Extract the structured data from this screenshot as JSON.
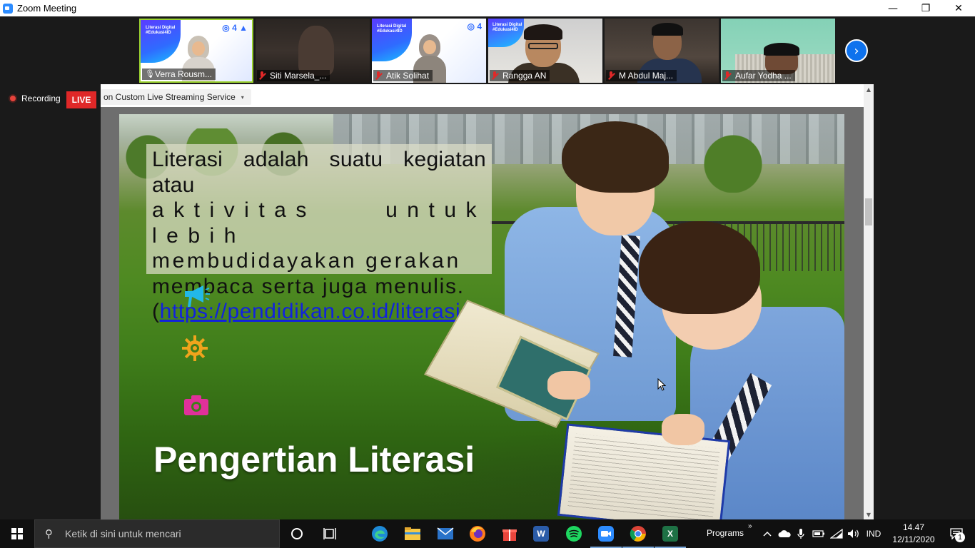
{
  "window": {
    "title": "Zoom Meeting",
    "controls": {
      "minimize": "—",
      "restore": "❐",
      "close": "✕"
    }
  },
  "participants": [
    {
      "name": "Verra Rousm...",
      "muted": false,
      "active": true,
      "thumb_title": "Literasi Digital #Edukasi4ID"
    },
    {
      "name": "Siti Marsela_...",
      "muted": true,
      "active": false
    },
    {
      "name": "Atik Solihat",
      "muted": true,
      "active": false,
      "thumb_title": "Literasi Digital #Edukasi4ID"
    },
    {
      "name": "Rangga AN",
      "muted": true,
      "active": false,
      "thumb_title": "Literasi Digital #Edukasi4ID"
    },
    {
      "name": "M Abdul Maj...",
      "muted": true,
      "active": false
    },
    {
      "name": "Aufar Yodha ...",
      "muted": true,
      "active": false
    }
  ],
  "participants_next": "›",
  "recording": {
    "label": "Recording",
    "live_badge": "LIVE"
  },
  "share": {
    "stream_menu_label": "on Custom Live Streaming Service",
    "stream_menu_caret": "▾"
  },
  "slide": {
    "quote_line1": "Literasi adalah suatu kegiatan atau",
    "quote_line2": "aktivitas untuk lebih",
    "quote_line3": "membudidayakan gerakan",
    "quote_line4": "membaca serta juga menulis.",
    "quote_open": "(",
    "quote_link": "https://pendidikan.co.id/literasi/",
    "quote_close": ")",
    "title": "Pengertian Literasi",
    "icons": [
      "megaphone-icon",
      "gear-icon",
      "camera-icon"
    ],
    "colors": {
      "megaphone": "#22b8e8",
      "gear": "#f0a41c",
      "camera": "#e0309a"
    }
  },
  "scrollbar": {
    "up": "▲",
    "down": "▼"
  },
  "taskbar": {
    "search_placeholder": "Ketik di sini untuk mencari",
    "programs_label": "Programs",
    "programs_chevron": "»",
    "language": "IND",
    "time": "14.47",
    "date": "12/11/2020",
    "notification_count": "1",
    "apps": [
      "cortana-icon",
      "task-view-icon",
      "edge-icon",
      "file-explorer-icon",
      "mail-icon",
      "firefox-icon",
      "gift-icon",
      "word-icon",
      "spotify-icon",
      "zoom-icon",
      "chrome-icon",
      "excel-icon"
    ]
  }
}
